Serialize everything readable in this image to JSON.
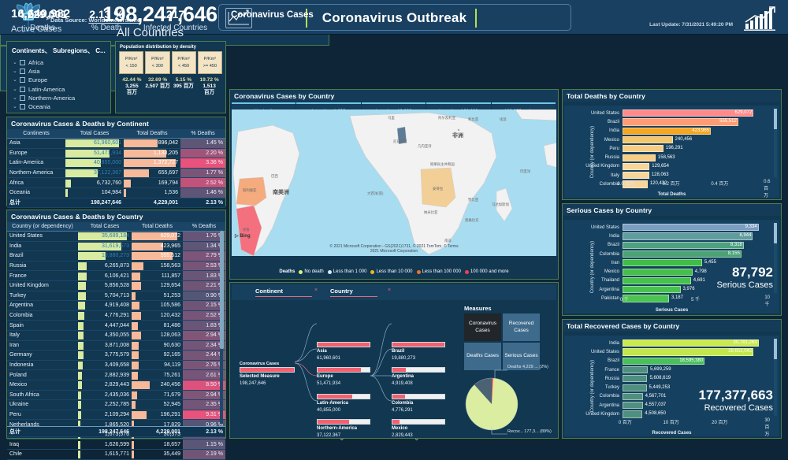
{
  "header": {
    "data_source_prefix": "Data Source: ",
    "data_source_link": "Worldometers.info",
    "title": "Coronavirus Outbreak",
    "last_update": "Last Update: 7/31/2021 5:49:20 PM",
    "logo_icon": "network-tree-icon",
    "title_icon": "line-chart-icon",
    "right_icon": "bar-chart-growth-icon"
  },
  "filter": {
    "title": "Continents、 Subregions、 C...",
    "items": [
      {
        "label": "Africa",
        "checked": false
      },
      {
        "label": "Asia",
        "checked": false
      },
      {
        "label": "Europe",
        "checked": false
      },
      {
        "label": "Latin-America",
        "checked": false
      },
      {
        "label": "Northern-America",
        "checked": false
      },
      {
        "label": "Oceania",
        "checked": false
      }
    ]
  },
  "population_density": {
    "title": "Population distribution by density",
    "buckets": [
      {
        "unit": "P/Km²",
        "range": "< 150",
        "pct": "42.44 %",
        "value": "3,255",
        "value_unit": "百万"
      },
      {
        "unit": "P/Km²",
        "range": "< 300",
        "pct": "32.69 %",
        "value": "2,507",
        "value_unit": "百万"
      },
      {
        "unit": "P/Km²",
        "range": "< 450",
        "pct": "5.15 %",
        "value": "395",
        "value_unit": "百万"
      },
      {
        "unit": "P/Km²",
        "range": ">= 450",
        "pct": "19.72 %",
        "value": "1,513",
        "value_unit": "百万"
      }
    ]
  },
  "continent_table": {
    "title": "Coronavirus Cases & Deaths by Continent",
    "columns": [
      "Continents",
      "Total Cases",
      "Total Deaths",
      "% Deaths"
    ],
    "sort_column": "Total Cases",
    "rows": [
      {
        "name": "Asia",
        "cases": "61,960,601",
        "deaths": "896,042",
        "pct": "1.45 %",
        "cases_w": 100,
        "deaths_w": 65,
        "pct_heat": 0.12
      },
      {
        "name": "Europe",
        "cases": "51,471,934",
        "deaths": "1,133,205",
        "pct": "2.20 %",
        "cases_w": 83,
        "deaths_w": 82,
        "pct_heat": 0.55
      },
      {
        "name": "Latin-America",
        "cases": "40,855,000",
        "deaths": "1,372,727",
        "pct": "3.36 %",
        "cases_w": 66,
        "deaths_w": 100,
        "pct_heat": 1.0
      },
      {
        "name": "Northern-America",
        "cases": "37,122,367",
        "deaths": "655,697",
        "pct": "1.77 %",
        "cases_w": 60,
        "deaths_w": 48,
        "pct_heat": 0.3
      },
      {
        "name": "Africa",
        "cases": "6,732,760",
        "deaths": "169,794",
        "pct": "2.52 %",
        "cases_w": 11,
        "deaths_w": 13,
        "pct_heat": 0.75
      },
      {
        "name": "Oceania",
        "cases": "104,984",
        "deaths": "1,536",
        "pct": "1.46 %",
        "cases_w": 1,
        "deaths_w": 1,
        "pct_heat": 0.13
      }
    ],
    "total": {
      "name": "总计",
      "cases": "198,247,646",
      "deaths": "4,229,001",
      "pct": "2.13 %"
    }
  },
  "country_table": {
    "title": "Coronavirus Cases & Deaths by Country",
    "columns": [
      "Country (or dependency)",
      "Total Cases",
      "Total Deaths",
      "% Deaths"
    ],
    "sort_column": "Total Cases",
    "rows": [
      {
        "name": "United States",
        "cases": "35,689,184",
        "deaths": "629,072",
        "pct": "1.76 %",
        "cases_w": 100,
        "deaths_w": 100,
        "pct_heat": 0.18
      },
      {
        "name": "India",
        "cases": "31,619,573",
        "deaths": "423,965",
        "pct": "1.34 %",
        "cases_w": 88,
        "deaths_w": 69,
        "pct_heat": 0.12
      },
      {
        "name": "Brazil",
        "cases": "19,880,273",
        "deaths": "555,512",
        "pct": "2.79 %",
        "cases_w": 56,
        "deaths_w": 89,
        "pct_heat": 0.32
      },
      {
        "name": "Russia",
        "cases": "6,265,873",
        "deaths": "158,563",
        "pct": "2.53 %",
        "cases_w": 18,
        "deaths_w": 26,
        "pct_heat": 0.28
      },
      {
        "name": "France",
        "cases": "6,106,421",
        "deaths": "111,857",
        "pct": "1.83 %",
        "cases_w": 17,
        "deaths_w": 19,
        "pct_heat": 0.19
      },
      {
        "name": "United Kingdom",
        "cases": "5,856,528",
        "deaths": "129,654",
        "pct": "2.21 %",
        "cases_w": 16,
        "deaths_w": 21,
        "pct_heat": 0.24
      },
      {
        "name": "Turkey",
        "cases": "5,704,713",
        "deaths": "51,253",
        "pct": "0.90 %",
        "cases_w": 16,
        "deaths_w": 9,
        "pct_heat": 0.06
      },
      {
        "name": "Argentina",
        "cases": "4,919,408",
        "deaths": "105,586",
        "pct": "2.15 %",
        "cases_w": 14,
        "deaths_w": 18,
        "pct_heat": 0.23
      },
      {
        "name": "Colombia",
        "cases": "4,776,291",
        "deaths": "120,432",
        "pct": "2.52 %",
        "cases_w": 13,
        "deaths_w": 20,
        "pct_heat": 0.28
      },
      {
        "name": "Spain",
        "cases": "4,447,044",
        "deaths": "81,486",
        "pct": "1.83 %",
        "cases_w": 12,
        "deaths_w": 14,
        "pct_heat": 0.19
      },
      {
        "name": "Italy",
        "cases": "4,350,055",
        "deaths": "128,063",
        "pct": "2.94 %",
        "cases_w": 12,
        "deaths_w": 21,
        "pct_heat": 0.34
      },
      {
        "name": "Iran",
        "cases": "3,871,008",
        "deaths": "90,630",
        "pct": "2.34 %",
        "cases_w": 11,
        "deaths_w": 15,
        "pct_heat": 0.26
      },
      {
        "name": "Germany",
        "cases": "3,775,579",
        "deaths": "92,165",
        "pct": "2.44 %",
        "cases_w": 11,
        "deaths_w": 15,
        "pct_heat": 0.27
      },
      {
        "name": "Indonesia",
        "cases": "3,409,658",
        "deaths": "94,119",
        "pct": "2.76 %",
        "cases_w": 10,
        "deaths_w": 16,
        "pct_heat": 0.31
      },
      {
        "name": "Poland",
        "cases": "2,882,939",
        "deaths": "75,261",
        "pct": "2.61 %",
        "cases_w": 8,
        "deaths_w": 13,
        "pct_heat": 0.29
      },
      {
        "name": "Mexico",
        "cases": "2,829,443",
        "deaths": "240,456",
        "pct": "8.50 %",
        "cases_w": 8,
        "deaths_w": 39,
        "pct_heat": 0.93
      },
      {
        "name": "South Africa",
        "cases": "2,435,036",
        "deaths": "71,679",
        "pct": "2.94 %",
        "cases_w": 7,
        "deaths_w": 12,
        "pct_heat": 0.34
      },
      {
        "name": "Ukraine",
        "cases": "2,252,785",
        "deaths": "52,945",
        "pct": "2.35 %",
        "cases_w": 6,
        "deaths_w": 9,
        "pct_heat": 0.26
      },
      {
        "name": "Peru",
        "cases": "2,109,294",
        "deaths": "196,291",
        "pct": "9.31 %",
        "cases_w": 6,
        "deaths_w": 32,
        "pct_heat": 1.0
      },
      {
        "name": "Netherlands",
        "cases": "1,865,520",
        "deaths": "17,829",
        "pct": "0.96 %",
        "cases_w": 5,
        "deaths_w": 3,
        "pct_heat": 0.07
      },
      {
        "name": "Czech Republic (Czechia)",
        "cases": "1,673,576",
        "deaths": "30,373",
        "pct": "1.81 %",
        "cases_w": 5,
        "deaths_w": 5,
        "pct_heat": 0.19
      },
      {
        "name": "Iraq",
        "cases": "1,626,599",
        "deaths": "18,657",
        "pct": "1.15 %",
        "cases_w": 5,
        "deaths_w": 3,
        "pct_heat": 0.1
      },
      {
        "name": "Chile",
        "cases": "1,615,771",
        "deaths": "35,449",
        "pct": "2.19 %",
        "cases_w": 5,
        "deaths_w": 6,
        "pct_heat": 0.24
      }
    ],
    "total": {
      "name": "总计",
      "cases": "198,247,646",
      "deaths": "4,229,001",
      "pct": "2.13 %"
    }
  },
  "kpi_main": {
    "active_value": "16,640,982",
    "active_label": "Active Cases",
    "total_value": "198,247,646",
    "total_label": "Coronavirus Cases",
    "scope_label": "All Countries"
  },
  "kpi_right": [
    {
      "value": "4,229,001",
      "label": "Deaths"
    },
    {
      "value": "2.13 %",
      "label": "% Death"
    },
    {
      "value": "217",
      "label": "Infected Countries"
    }
  ],
  "map": {
    "title": "Coronavirus Cases by Country",
    "top_legend": [
      "No death",
      "Less than 1 000",
      "Less than 10 000",
      "Less than 100 000",
      "100 000 and more"
    ],
    "legend_title": "Deaths",
    "legend": [
      {
        "label": "No death",
        "color": "#d9f27a"
      },
      {
        "label": "Less than 1 000",
        "color": "#dfe8ee"
      },
      {
        "label": "Less than 10 000",
        "color": "#f0b429"
      },
      {
        "label": "Less than 100 000",
        "color": "#ef7427"
      },
      {
        "label": "100 000 and more",
        "color": "#ef4055"
      }
    ],
    "bing_tag": "Bing",
    "attribution_line1": "© 2021 Microsoft Corporation - GS(2021)1731, © 2021 TomTom, © Terms",
    "attribution_line2": "2021 Microsoft Corporation",
    "country_labels": [
      "巴西",
      "南美洲",
      "非洲",
      "玻利维亚",
      "秘鲁",
      "安哥拉",
      "刚果民主共和国",
      "纳米比亚",
      "南非",
      "马达加斯加",
      "莫桑比克",
      "赞比亚",
      "尼日利亚",
      "马里",
      "阿尔及利亚",
      "利比亚",
      "埃及",
      "几内亚湾",
      "大西洋(南)",
      "印度洋"
    ]
  },
  "tree": {
    "header_levels": [
      {
        "label": "Continent",
        "close": "×"
      },
      {
        "label": "Country",
        "close": "×"
      }
    ],
    "root": {
      "title": "Coronavirus Cases",
      "label": "Selected Measure",
      "value": "198,247,646",
      "fill": 100
    },
    "level1": [
      {
        "label": "Asia",
        "value": "61,960,601",
        "fill": 100
      },
      {
        "label": "Europe",
        "value": "51,471,934",
        "fill": 83
      },
      {
        "label": "Latin-America",
        "value": "40,855,000",
        "fill": 66
      },
      {
        "label": "Northern-America",
        "value": "37,122,367",
        "fill": 60
      }
    ],
    "level2": [
      {
        "label": "Brazil",
        "value": "19,880,273",
        "fill": 100
      },
      {
        "label": "Argentina",
        "value": "4,919,408",
        "fill": 25
      },
      {
        "label": "Colombia",
        "value": "4,776,291",
        "fill": 24
      },
      {
        "label": "Mexico",
        "value": "2,829,443",
        "fill": 14
      }
    ],
    "measures_title": "Measures",
    "measures": [
      {
        "label": "Coronavirus Cases",
        "selected": true
      },
      {
        "label": "Recovered Cases",
        "selected": false
      },
      {
        "label": "Deaths Cases",
        "selected": false
      },
      {
        "label": "Serious Cases",
        "selected": false
      }
    ],
    "pie": {
      "deaths_label": "Deaths 4,229 ... (2%)",
      "recovered_label": "Recov... 177,3... (89%)",
      "slices": [
        {
          "name": "Recovered",
          "pct": 89,
          "color": "#dbeda0"
        },
        {
          "name": "Active",
          "pct": 9,
          "color": "#4a6274"
        },
        {
          "name": "Deaths",
          "pct": 2,
          "color": "#ef4055"
        }
      ]
    }
  },
  "chart_data": [
    {
      "type": "bar",
      "panel": "total-deaths-by-country",
      "title": "Total Deaths by Country",
      "ylabel": "Country (or dependency)",
      "xlabel": "Total Deaths",
      "orientation": "horizontal",
      "categories": [
        "United States",
        "Brazil",
        "India",
        "Mexico",
        "Peru",
        "Russia",
        "United Kingdom",
        "Italy",
        "Colombia"
      ],
      "values": [
        629072,
        555512,
        423965,
        240456,
        196291,
        158563,
        129654,
        128063,
        120432
      ],
      "value_labels": [
        "629,072",
        "555,512",
        "423,965",
        "240,456",
        "196,291",
        "158,563",
        "129,654",
        "128,063",
        "120,432"
      ],
      "colors": [
        "#ff8a8a",
        "#ff9c73",
        "#f5a623",
        "#f7c56a",
        "#f8cd83",
        "#f8cd83",
        "#f9d59a",
        "#f9d59a",
        "#f9d59a"
      ],
      "xticks": [
        "0.0 百万",
        "0.2 百万",
        "0.4 百万",
        "0.6 百万"
      ],
      "xlim": [
        0,
        700000
      ]
    },
    {
      "type": "bar",
      "panel": "serious-cases-by-country",
      "title": "Serious Cases by Country",
      "ylabel": "Country (or dependency)",
      "xlabel": "Serious Cases",
      "orientation": "horizontal",
      "categories": [
        "United States",
        "India",
        "Brazil",
        "Colombia",
        "Iran",
        "Mexico",
        "Thailand",
        "Argentina",
        "Pakistan"
      ],
      "values": [
        9334,
        8944,
        8318,
        8155,
        5455,
        4798,
        4691,
        3976,
        3187
      ],
      "value_labels": [
        "9,334",
        "8,944",
        "8,318",
        "8,155",
        "5,455",
        "4,798",
        "4,691",
        "3,976",
        "3,187"
      ],
      "colors": [
        "#7b9ec0",
        "#5f9c9e",
        "#4fa07f",
        "#4aa275",
        "#3fbd46",
        "#44c04a",
        "#46c14c",
        "#48c24e",
        "#4ac350"
      ],
      "xticks": [
        "0 千",
        "5 千",
        "10 千"
      ],
      "xlim": [
        0,
        10000
      ],
      "overlay": {
        "value": "87,792",
        "label": "Serious Cases"
      }
    },
    {
      "type": "bar",
      "panel": "total-recovered-cases-by-country",
      "title": "Total Recovered Cases by Country",
      "ylabel": "Country (or dependency)",
      "xlabel": "Recovered Cases",
      "orientation": "horizontal",
      "categories": [
        "India",
        "United States",
        "Brazil",
        "France",
        "Russia",
        "Turkey",
        "Colombia",
        "Argentina",
        "United Kingdom"
      ],
      "values": [
        30781263,
        29652042,
        18595380,
        5699259,
        5608619,
        5449253,
        4567701,
        4557037,
        4508650
      ],
      "value_labels": [
        "30,781,263",
        "29,652,042",
        "18,595,380",
        "5,699,259",
        "5,608,619",
        "5,449,253",
        "4,567,701",
        "4,557,037",
        "4,508,650"
      ],
      "colors": [
        "#cbe84f",
        "#c3e64a",
        "#4cbf5c",
        "#4f8f7f",
        "#4f8f7f",
        "#4f8f7f",
        "#4f8f7f",
        "#4f8f7f",
        "#4f8f7f"
      ],
      "xticks": [
        "0 百万",
        "10 百万",
        "20 百万",
        "30 百万"
      ],
      "xlim": [
        0,
        33000000
      ],
      "overlay": {
        "value": "177,377,663",
        "label": "Recovered Cases"
      }
    }
  ]
}
